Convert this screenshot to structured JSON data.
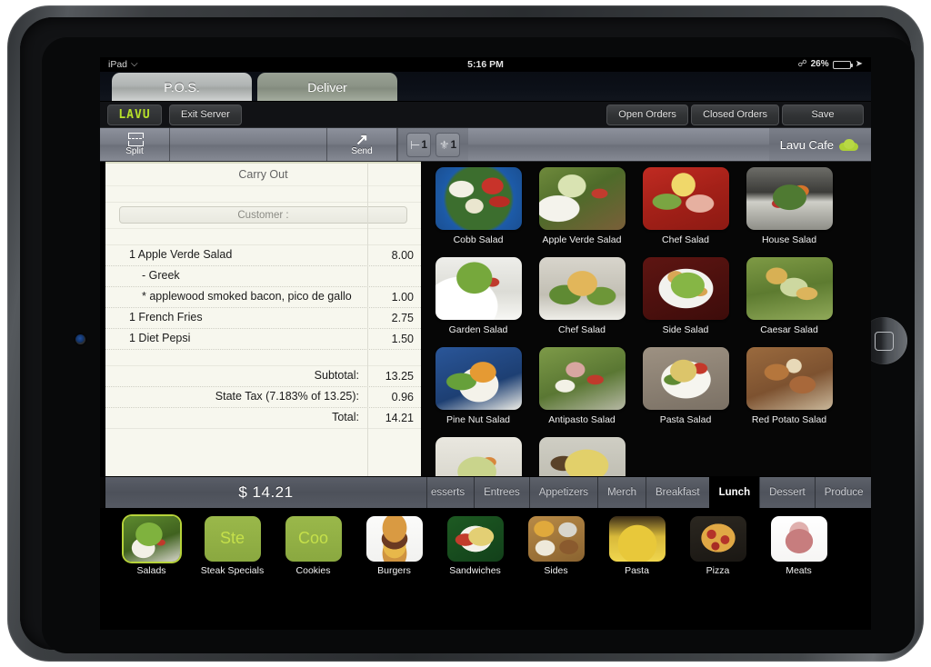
{
  "statusbar": {
    "device": "iPad",
    "wifi_icon": "wifi-icon",
    "time": "5:16 PM",
    "bluetooth_icon": "bluetooth-icon",
    "battery_percent": "26%",
    "battery_level": 26,
    "charging_icon": "lightning-bolt-icon"
  },
  "mode_tabs": [
    {
      "label": "P.O.S.",
      "active": true
    },
    {
      "label": "Deliver",
      "active": false
    }
  ],
  "actionbar": {
    "logo_text": "LAVU",
    "logo_color": "#b7e02a",
    "exit_server_label": "Exit Server",
    "buttons": [
      {
        "label": "Open Orders"
      },
      {
        "label": "Closed Orders"
      },
      {
        "label": "Save"
      }
    ]
  },
  "ticket_toolbar": {
    "split_label": "Split",
    "send_label": "Send",
    "badges": [
      {
        "icon": "table-seat-icon",
        "glyph": "⊦",
        "count": "1"
      },
      {
        "icon": "utensil-fork-icon",
        "glyph": "🍴",
        "count": "1"
      }
    ],
    "venue_name": "Lavu Cafe",
    "venue_logo": "cloud-icon"
  },
  "ticket": {
    "order_type": "Carry Out",
    "customer_placeholder": "Customer :",
    "lines": [
      {
        "qty": "1",
        "name": "Apple Verde Salad",
        "text": "1 Apple Verde Salad",
        "price": "8.00",
        "type": "item"
      },
      {
        "text": "- Greek",
        "price": "",
        "type": "modifier"
      },
      {
        "text": "* applewood smoked bacon, pico de gallo",
        "price": "1.00",
        "type": "modifier"
      },
      {
        "qty": "1",
        "name": "French Fries",
        "text": "1 French Fries",
        "price": "2.75",
        "type": "item"
      },
      {
        "qty": "1",
        "name": "Diet Pepsi",
        "text": "1 Diet Pepsi",
        "price": "1.50",
        "type": "item"
      }
    ],
    "totals": [
      {
        "label": "Subtotal:",
        "value": "13.25"
      },
      {
        "label": "State Tax (7.183% of 13.25):",
        "value": "0.96"
      },
      {
        "label": "Total:",
        "value": "14.21"
      }
    ]
  },
  "menu_items": [
    {
      "label": "Cobb Salad"
    },
    {
      "label": "Apple Verde Salad"
    },
    {
      "label": "Chef Salad"
    },
    {
      "label": "House Salad"
    },
    {
      "label": "Garden Salad"
    },
    {
      "label": "Chef Salad"
    },
    {
      "label": "Side Salad"
    },
    {
      "label": "Caesar Salad"
    },
    {
      "label": "Pine Nut Salad"
    },
    {
      "label": "Antipasto Salad"
    },
    {
      "label": "Pasta Salad"
    },
    {
      "label": "Red Potato Salad"
    },
    {
      "label": ""
    },
    {
      "label": ""
    }
  ],
  "total_bar": {
    "amount": "$ 14.21"
  },
  "category_tabs": [
    {
      "label": "esserts",
      "active": false,
      "clipped": true
    },
    {
      "label": "Entrees",
      "active": false
    },
    {
      "label": "Appetizers",
      "active": false
    },
    {
      "label": "Merch",
      "active": false
    },
    {
      "label": "Breakfast",
      "active": false
    },
    {
      "label": "Lunch",
      "active": true
    },
    {
      "label": "Dessert",
      "active": false
    },
    {
      "label": "Produce",
      "active": false
    }
  ],
  "dock_categories": [
    {
      "label": "Salads",
      "selected": true,
      "placeholder": false,
      "short": ""
    },
    {
      "label": "Steak Specials",
      "selected": false,
      "placeholder": true,
      "short": "Ste"
    },
    {
      "label": "Cookies",
      "selected": false,
      "placeholder": true,
      "short": "Coo"
    },
    {
      "label": "Burgers",
      "selected": false,
      "placeholder": false,
      "short": ""
    },
    {
      "label": "Sandwiches",
      "selected": false,
      "placeholder": false,
      "short": ""
    },
    {
      "label": "Sides",
      "selected": false,
      "placeholder": false,
      "short": ""
    },
    {
      "label": "Pasta",
      "selected": false,
      "placeholder": false,
      "short": ""
    },
    {
      "label": "Pizza",
      "selected": false,
      "placeholder": false,
      "short": ""
    },
    {
      "label": "Meats",
      "selected": false,
      "placeholder": false,
      "short": ""
    }
  ]
}
